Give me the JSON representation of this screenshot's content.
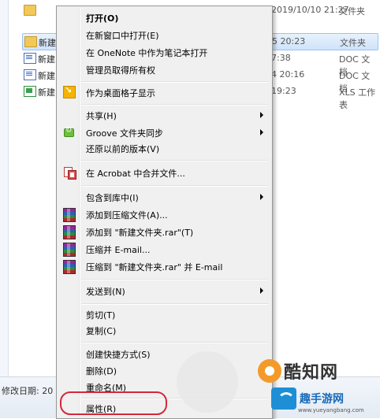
{
  "explorer": {
    "files": [
      {
        "name": "",
        "date": "2019/10/10 21:27",
        "type": "文件夹",
        "icon": "folder-icon",
        "selected": false
      },
      {
        "name": "新建",
        "date": "5 20:23",
        "type": "文件夹",
        "icon": "folder-icon",
        "selected": true
      },
      {
        "name": "新建",
        "date": "7:38",
        "type": "DOC 文档",
        "icon": "doc-icon",
        "selected": false
      },
      {
        "name": "新建",
        "date": "4 20:16",
        "type": "DOC 文档",
        "icon": "doc-icon",
        "selected": false
      },
      {
        "name": "新建",
        "date": "19:23",
        "type": "XLS 工作表",
        "icon": "xls-icon",
        "selected": false
      }
    ],
    "status_label": "修改日期: 20"
  },
  "menu": {
    "items": [
      {
        "label": "打开(O)",
        "bold": true
      },
      {
        "label": "在新窗口中打开(E)"
      },
      {
        "label": "在 OneNote 中作为笔记本打开"
      },
      {
        "label": "管理员取得所有权"
      },
      {
        "label": "作为桌面格子显示",
        "icon": "desktop-grid-icon"
      },
      {
        "label": "共享(H)",
        "submenu": true
      },
      {
        "label": "Groove 文件夹同步",
        "submenu": true,
        "icon": "groove-sync-icon"
      },
      {
        "label": "还原以前的版本(V)"
      },
      {
        "label": "在 Acrobat 中合并文件...",
        "icon": "acrobat-icon"
      },
      {
        "label": "包含到库中(I)",
        "submenu": true
      },
      {
        "label": "添加到压缩文件(A)...",
        "icon": "winrar-icon"
      },
      {
        "label": "添加到 \"新建文件夹.rar\"(T)",
        "icon": "winrar-icon"
      },
      {
        "label": "压缩并 E-mail...",
        "icon": "winrar-icon"
      },
      {
        "label": "压缩到 \"新建文件夹.rar\" 并 E-mail",
        "icon": "winrar-icon"
      },
      {
        "label": "发送到(N)",
        "submenu": true
      },
      {
        "label": "剪切(T)"
      },
      {
        "label": "复制(C)"
      },
      {
        "label": "创建快捷方式(S)"
      },
      {
        "label": "删除(D)"
      },
      {
        "label": "重命名(M)"
      },
      {
        "label": "属性(R)"
      }
    ]
  },
  "watermark": {
    "brand": "酷知网",
    "brand2": "趣手游网",
    "url": "www.yueyangbang.com"
  },
  "colors": {
    "highlight": "#d2283a",
    "menu_bg": "#f0f0f0",
    "selection": "#cfe3fa"
  }
}
